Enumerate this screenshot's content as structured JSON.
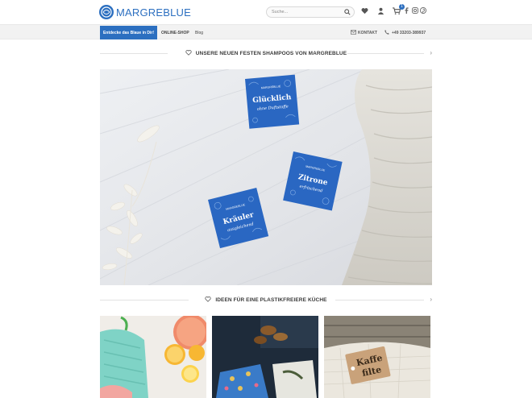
{
  "header": {
    "logo_text": "MARGREBLUE",
    "search_placeholder": "Suche...",
    "cart_count": "1"
  },
  "nav": {
    "highlight_button": "Entdecke das Blaue in Dir!",
    "links": [
      "ONLINE-SHOP",
      "Blog"
    ],
    "contact_label": "KONTAKT",
    "phone": "+49 33203-389937"
  },
  "sections": {
    "shampoos_title": "UNSERE NEUEN FESTEN SHAMPOOS VON MARGREBLUE",
    "kitchen_title": "IDEEN FÜR EINE PLASTIKFREIERE KÜCHE"
  },
  "hero_products": {
    "box1": {
      "line1": "Glücklich",
      "line2": "ohne Duftstoffe",
      "brand": "MARGREBLUE"
    },
    "box2": {
      "line1": "Zitrone",
      "line2": "erfrischend",
      "brand": "MARGREBLUE"
    },
    "box3": {
      "line1": "Kräuler",
      "line2": "ausgleichend",
      "brand": "MARGREBLUE"
    }
  },
  "thumb3_tag": {
    "line1": "Kaffe",
    "line2": "filte"
  },
  "colors": {
    "brand": "#2c6fc0",
    "nav_bg": "#f2f2f2"
  }
}
